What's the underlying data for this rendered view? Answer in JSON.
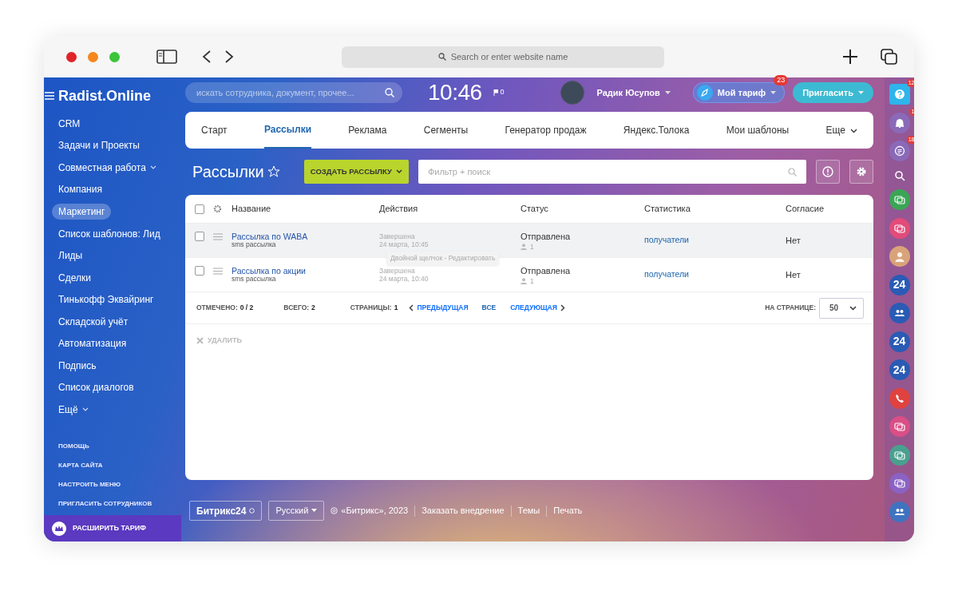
{
  "browser": {
    "address_placeholder": "Search or enter website name"
  },
  "header": {
    "logo": "Radist.Online",
    "search_placeholder": "искать сотрудника, документ, прочее...",
    "time": "10:46",
    "flag_count": "0",
    "user_name": "Радик Юсупов",
    "tariff": {
      "label": "Мой тариф",
      "badge": "23"
    },
    "invite": "Пригласить"
  },
  "sidebar": {
    "items": [
      {
        "label": "CRM",
        "selected": false,
        "dropdown": false
      },
      {
        "label": "Задачи и Проекты",
        "selected": false,
        "dropdown": false
      },
      {
        "label": "Совместная работа",
        "selected": false,
        "dropdown": true
      },
      {
        "label": "Компания",
        "selected": false,
        "dropdown": false
      },
      {
        "label": "Маркетинг",
        "selected": true,
        "dropdown": false
      },
      {
        "label": "Список шаблонов: Лид",
        "selected": false,
        "dropdown": false
      },
      {
        "label": "Лиды",
        "selected": false,
        "dropdown": false
      },
      {
        "label": "Сделки",
        "selected": false,
        "dropdown": false
      },
      {
        "label": "Тинькофф Эквайринг",
        "selected": false,
        "dropdown": false
      },
      {
        "label": "Складской учёт",
        "selected": false,
        "dropdown": false
      },
      {
        "label": "Автоматизация",
        "selected": false,
        "dropdown": false
      },
      {
        "label": "Подпись",
        "selected": false,
        "dropdown": false
      },
      {
        "label": "Список диалогов",
        "selected": false,
        "dropdown": false
      },
      {
        "label": "Ещё",
        "selected": false,
        "dropdown": true
      }
    ],
    "links": [
      "ПОМОЩЬ",
      "КАРТА САЙТА",
      "НАСТРОИТЬ МЕНЮ",
      "ПРИГЛАСИТЬ СОТРУДНИКОВ"
    ],
    "upgrade": "РАСШИРИТЬ ТАРИФ"
  },
  "tabs": [
    {
      "label": "Старт",
      "selected": false
    },
    {
      "label": "Рассылки",
      "selected": true
    },
    {
      "label": "Реклама",
      "selected": false
    },
    {
      "label": "Сегменты",
      "selected": false
    },
    {
      "label": "Генератор продаж",
      "selected": false
    },
    {
      "label": "Яндекс.Толока",
      "selected": false
    },
    {
      "label": "Мои шаблоны",
      "selected": false
    }
  ],
  "more_tab": "Еще",
  "page": {
    "title": "Рассылки",
    "create_button": "СОЗДАТЬ РАССЫЛКУ",
    "filter_placeholder": "Фильтр + поиск"
  },
  "table": {
    "select_all_checked": false,
    "columns": [
      "Название",
      "Действия",
      "Статус",
      "Статистика",
      "Согласие"
    ],
    "rows": [
      {
        "name": "Рассылка по WABA",
        "type": "sms рассылка",
        "action_state": "Завершена",
        "action_date": "24 марта, 10:45",
        "status": "Отправлена",
        "recipients": "1",
        "stats_link": "получатели",
        "consent": "Нет",
        "checked": false,
        "hovered": true
      },
      {
        "name": "Рассылка по акции",
        "type": "sms рассылка",
        "action_state": "Завершена",
        "action_date": "24 марта, 10:40",
        "status": "Отправлена",
        "recipients": "1",
        "stats_link": "получатели",
        "consent": "Нет",
        "checked": false,
        "hovered": false
      }
    ],
    "tooltip": "Двойной щелчок - Редактировать",
    "summary": {
      "checked_label": "ОТМЕЧЕНО:",
      "checked_value": "0 / 2",
      "total_label": "ВСЕГО:",
      "total_value": "2",
      "pages_label": "СТРАНИЦЫ:",
      "pages_value": "1",
      "prev": "ПРЕДЫДУЩАЯ",
      "all": "ВСЕ",
      "next": "СЛЕДУЮЩАЯ",
      "per_page_label": "НА СТРАНИЦЕ:",
      "per_page": "50"
    },
    "delete_action": {
      "label": "УДАЛИТЬ",
      "disabled": true
    }
  },
  "footer": {
    "brand": "Битрикс24",
    "language": "Русский",
    "copyright": "«Битрикс», 2023",
    "links": [
      "Заказать внедрение",
      "Темы",
      "Печать"
    ]
  },
  "right_strip": [
    {
      "kind": "help",
      "badge": "12",
      "color": "#2fb4ec"
    },
    {
      "kind": "bell",
      "badge": "1",
      "color": "#8a6ab8"
    },
    {
      "kind": "chat",
      "badge": "18",
      "color": "#8a6ab8"
    },
    {
      "kind": "search"
    },
    {
      "kind": "openline",
      "color": "#3aa655"
    },
    {
      "kind": "openline",
      "color": "#e24b7a"
    },
    {
      "kind": "avatar",
      "color": "#d9a37a"
    },
    {
      "kind": "number",
      "text": "24",
      "color": "#2a5bb5"
    },
    {
      "kind": "group",
      "color": "#2a5bb5"
    },
    {
      "kind": "number",
      "text": "24",
      "color": "#2a5bb5"
    },
    {
      "kind": "number",
      "text": "24",
      "color": "#2a5bb5"
    },
    {
      "kind": "phone",
      "color": "#e0433f"
    },
    {
      "kind": "openline",
      "color": "#d94f86"
    },
    {
      "kind": "openline",
      "color": "#4aa08e"
    },
    {
      "kind": "openline",
      "color": "#8b62c4"
    },
    {
      "kind": "group",
      "color": "#3f73c0"
    }
  ]
}
